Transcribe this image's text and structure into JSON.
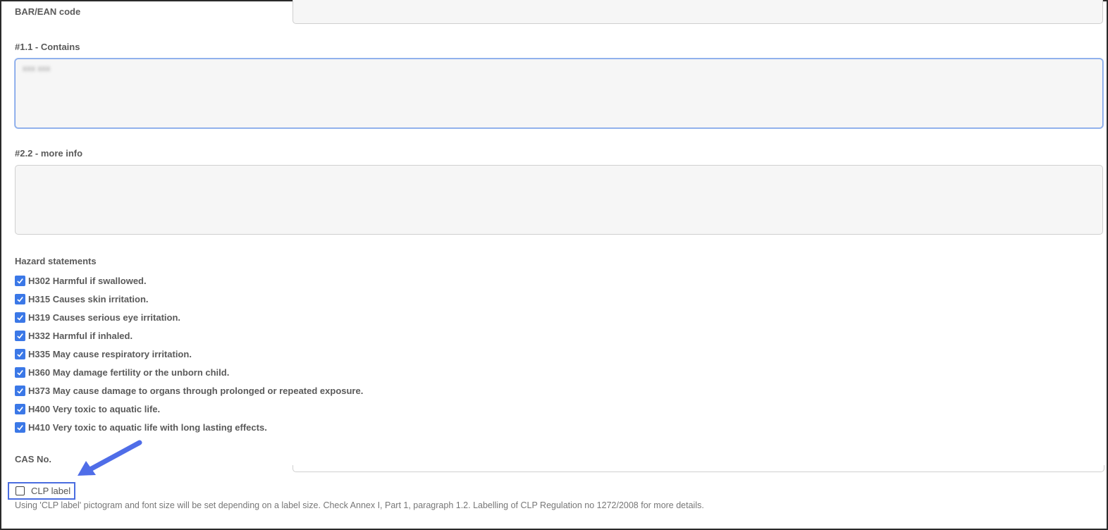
{
  "form": {
    "barcode": {
      "label": "BAR/EAN code",
      "value": ""
    },
    "contains": {
      "label": "#1.1 - Contains",
      "value": "xxx xxx"
    },
    "more_info": {
      "label": "#2.2 - more info",
      "value": ""
    },
    "hazard": {
      "label": "Hazard statements",
      "items": [
        {
          "text": "H302 Harmful if swallowed.",
          "checked": true
        },
        {
          "text": "H315 Causes skin irritation.",
          "checked": true
        },
        {
          "text": "H319 Causes serious eye irritation.",
          "checked": true
        },
        {
          "text": "H332 Harmful if inhaled.",
          "checked": true
        },
        {
          "text": "H335 May cause respiratory irritation.",
          "checked": true
        },
        {
          "text": "H360 May damage fertility or the unborn child.",
          "checked": true
        },
        {
          "text": "H373 May cause damage to organs through prolonged or repeated exposure.",
          "checked": true
        },
        {
          "text": "H400 Very toxic to aquatic life.",
          "checked": true
        },
        {
          "text": "H410 Very toxic to aquatic life with long lasting effects.",
          "checked": true
        }
      ]
    },
    "cas": {
      "label": "CAS No.",
      "value": ""
    },
    "clp": {
      "label": "CLP label",
      "checked": false,
      "help": "Using 'CLP label' pictogram and font size will be set depending on a label size. Check Annex I, Part 1, paragraph 1.2. Labelling of CLP Regulation no 1272/2008 for more details."
    }
  },
  "colors": {
    "accent": "#3b78e7",
    "highlight": "#4a6de0"
  }
}
